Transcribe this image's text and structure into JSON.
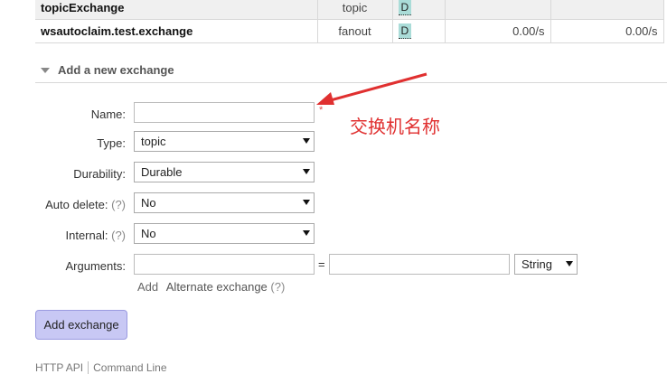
{
  "exchanges": [
    {
      "name": "topicExchange",
      "type": "topic",
      "features": "D",
      "rate_in": "",
      "rate_out": ""
    },
    {
      "name": "wsautoclaim.test.exchange",
      "type": "fanout",
      "features": "D",
      "rate_in": "0.00/s",
      "rate_out": "0.00/s"
    }
  ],
  "section": {
    "title": "Add a new exchange"
  },
  "form": {
    "name_label": "Name:",
    "name_value": "",
    "required_mark": "*",
    "type_label": "Type:",
    "type_value": "topic",
    "durability_label": "Durability:",
    "durability_value": "Durable",
    "auto_delete_label": "Auto delete:",
    "auto_delete_value": "No",
    "internal_label": "Internal:",
    "internal_value": "No",
    "help_mark": "(?)",
    "arguments_label": "Arguments:",
    "arguments_eq": "=",
    "arguments_type": "String",
    "add_link": "Add",
    "alternate_exchange": "Alternate exchange",
    "submit": "Add exchange"
  },
  "annotation": {
    "text": "交换机名称",
    "color": "#e03030"
  },
  "footer": {
    "http_api": "HTTP API",
    "command_line": "Command Line"
  }
}
